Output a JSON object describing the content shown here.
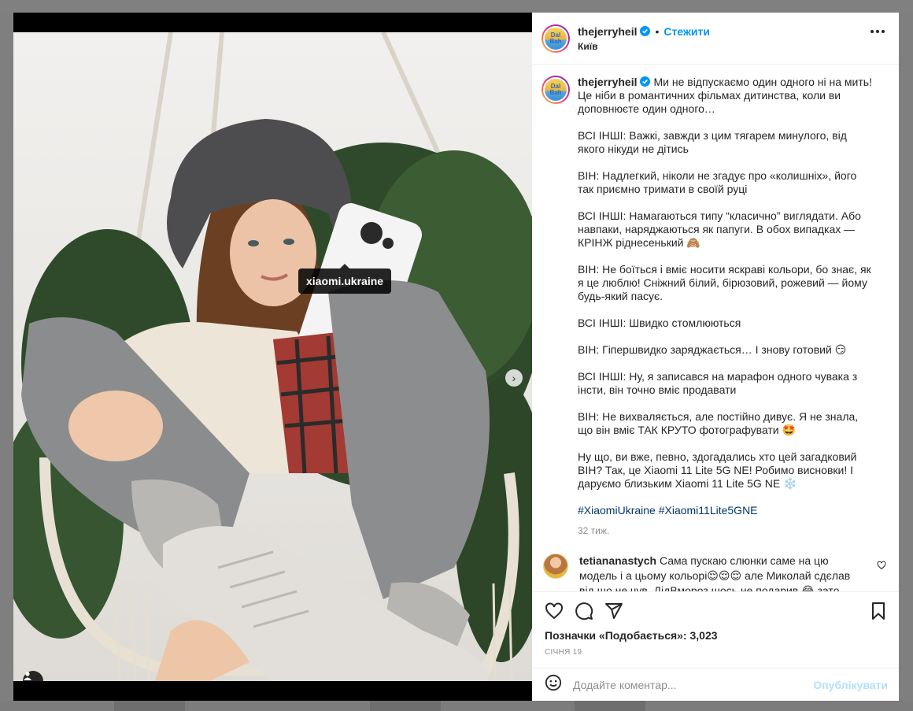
{
  "post": {
    "username": "thejerryheil",
    "follow_label": "Стежити",
    "location": "Київ",
    "avatar_text": "Dal Bah",
    "photo_tag": "xiaomi.ukraine"
  },
  "caption": {
    "username": "thejerryheil",
    "paragraphs": [
      "Ми не відпускаємо один одного ні на мить! Це ніби в романтичних фільмах дитинства, коли ви доповнюєте один одного…",
      "ВСІ ІНШІ: Важкі, завжди з цим тягарем минулого, від якого нікуди не дітись",
      "ВІН: Надлегкий, ніколи не згадує про «колишніх», його так приємно тримати в своїй руці",
      "ВСІ ІНШІ: Намагаються типу “класично” виглядати. Або навпаки, наряджаються як папуги. В обох випадках — КРІНЖ ріднесенький 🙈",
      "ВІН: Не боїться і вміє носити яскраві кольори, бо знає, як я це люблю! Сніжний білий, бірюзовий, рожевий — йому будь-який пасує.",
      "ВСІ ІНШІ: Швидко стомлюються",
      "ВІН: Гіпершвидко заряджається… І знову готовий 😏",
      "ВСІ ІНШІ: Ну, я записався на марафон одного чувака з інсти, він точно вміє продавати",
      "ВІН: Не вихваляється, але постійно дивує. Я не знала, що він вміє ТАК КРУТО фотографувати 🤩",
      "Ну що, ви вже, певно, здогадались хто цей загадковий ВІН? Так, це Xiaomi 11 Lite 5G NE! Робимо висновки! І даруємо близьким Xiaomi 11 Lite 5G NE ❄️"
    ],
    "hashtags": "#XiaomiUkraine #Xiaomi11Lite5GNE",
    "time": "32 тиж."
  },
  "comments": [
    {
      "username": "tetiananastych",
      "text": "Сама пускаю слюнки саме на цю модель і а цьому кольорі😌😌😌 але Миколай сдєлав від що не чув, ДідВмороз шось не подарив 😂 зато корону подарив…"
    }
  ],
  "stats": {
    "likes_label": "Позначки «Подобається»: 3,023",
    "date": "січня 19"
  },
  "comment_box": {
    "placeholder": "Додайте коментар...",
    "post_label": "Опублікувати"
  },
  "icons": {
    "like": "heart-icon",
    "comment": "comment-icon",
    "share": "share-icon",
    "save": "bookmark-icon",
    "emoji": "emoji-icon",
    "more": "more-icon",
    "verified": "verified-badge-icon",
    "tagged_user": "user-tag-icon"
  },
  "colors": {
    "link": "#0095f6",
    "hashtag": "#00376b",
    "post_disabled": "#b2dffc"
  }
}
